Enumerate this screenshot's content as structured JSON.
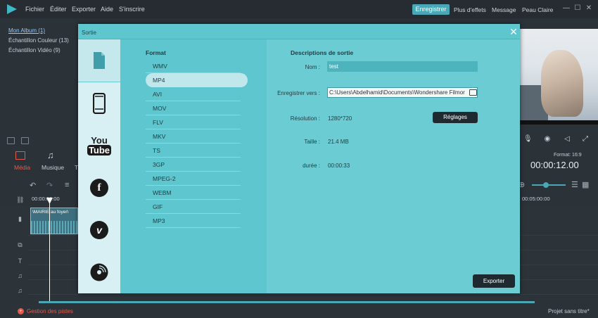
{
  "menu": [
    "Fichier",
    "Éditer",
    "Exporter",
    "Aide",
    "S'inscrire"
  ],
  "topbar": {
    "export_button": "Enregistrer",
    "links": [
      "Plus d'effets",
      "Message",
      "Peau Claire"
    ]
  },
  "media_library": {
    "albums": [
      "Mon Album (1)",
      "Échantillon Couleur (13)",
      "Échantillon Vidéo (9)"
    ],
    "tabs": [
      "Média",
      "Musique",
      "T"
    ]
  },
  "preview": {
    "format": "Format: 16:9",
    "timecode": "00:00:12.00"
  },
  "timeline": {
    "ruler_start": "00:00:00:00",
    "ruler_mid": "00:05:00:00",
    "clip_title": "\\MAIRIE au foyer\\",
    "track_manager": "Gestion des pistes",
    "project_name": "Projet sans titre*"
  },
  "dialog": {
    "title": "Sortie",
    "format_heading": "Format",
    "formats": [
      "WMV",
      "MP4",
      "AVI",
      "MOV",
      "FLV",
      "MKV",
      "TS",
      "3GP",
      "MPEG-2",
      "WEBM",
      "GIF",
      "MP3"
    ],
    "selected_format": "MP4",
    "desc_heading": "Descriptions de sortie",
    "labels": {
      "name": "Nom :",
      "save_to": "Enregistrer vers :",
      "resolution": "Résolution :",
      "size": "Taille :",
      "duration": "durée :"
    },
    "values": {
      "name": "test",
      "path": "C:\\Users\\Abdelhamid\\Documents\\Wondershare Filmor",
      "resolution": "1280*720",
      "size": "21.4 MB",
      "duration": "00:00:33"
    },
    "settings_button": "Réglages",
    "export_button": "Exporter",
    "destinations": [
      "file-icon",
      "phone-icon",
      "youtube-icon",
      "facebook-icon",
      "vimeo-icon",
      "dvd-icon"
    ],
    "youtube_text": [
      "You",
      "Tube"
    ],
    "facebook_glyph": "f",
    "vimeo_glyph": "v"
  },
  "colors": {
    "accent": "#4aa7b6",
    "dialog_bg": "#5fc5cd",
    "dark_button": "#1f2a30",
    "danger": "#e25b4d"
  }
}
